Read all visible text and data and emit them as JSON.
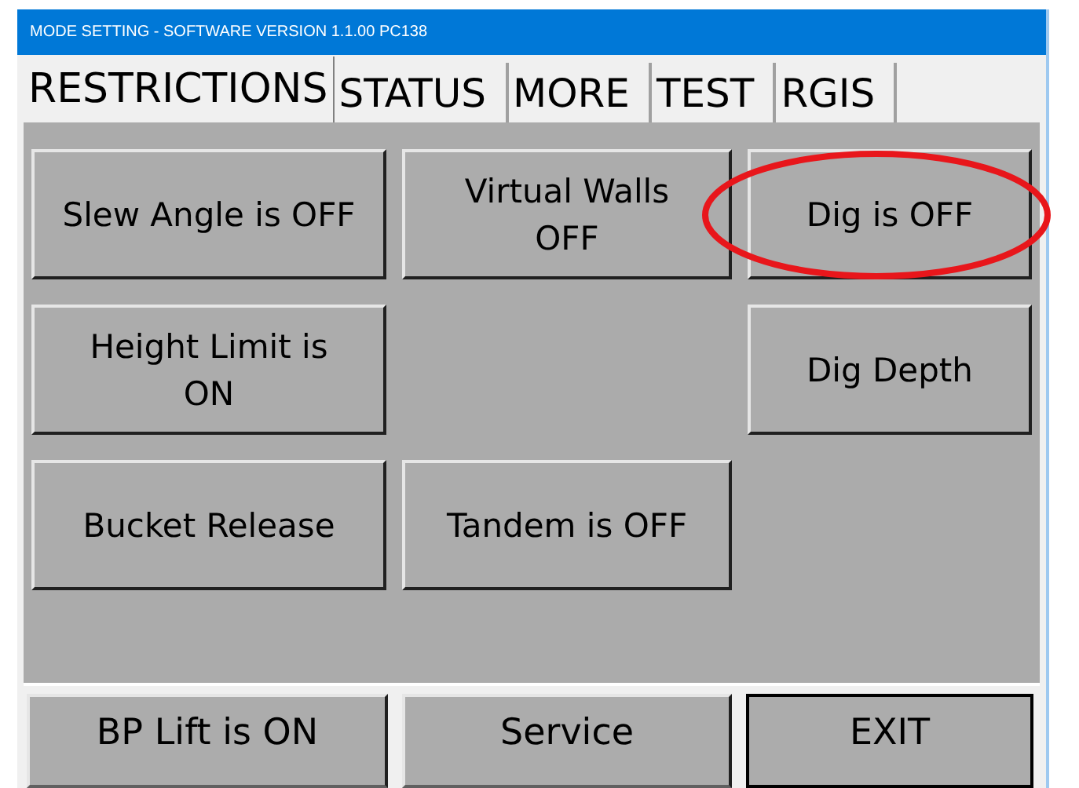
{
  "window": {
    "title": "MODE SETTING - SOFTWARE VERSION 1.1.00 PC138"
  },
  "tabs": [
    {
      "label": "RESTRICTIONS",
      "selected": true
    },
    {
      "label": "STATUS",
      "selected": false
    },
    {
      "label": "MORE",
      "selected": false
    },
    {
      "label": "TEST",
      "selected": false
    },
    {
      "label": "RGIS",
      "selected": false
    }
  ],
  "grid": [
    {
      "kind": "button",
      "label": "Slew Angle is OFF",
      "circled": false
    },
    {
      "kind": "button",
      "label": "Virtual Walls\nOFF",
      "circled": false
    },
    {
      "kind": "button",
      "label": "Dig is OFF",
      "circled": true
    },
    {
      "kind": "button",
      "label": "Height Limit is\nON",
      "circled": false
    },
    {
      "kind": "empty"
    },
    {
      "kind": "button",
      "label": "Dig Depth",
      "circled": false
    },
    {
      "kind": "button",
      "label": "Bucket Release",
      "circled": false
    },
    {
      "kind": "button",
      "label": "Tandem is OFF",
      "circled": false
    },
    {
      "kind": "empty"
    }
  ],
  "bottom_buttons": [
    {
      "label": "BP Lift is ON",
      "default": false
    },
    {
      "label": "Service",
      "default": false
    },
    {
      "label": "EXIT",
      "default": true
    }
  ]
}
